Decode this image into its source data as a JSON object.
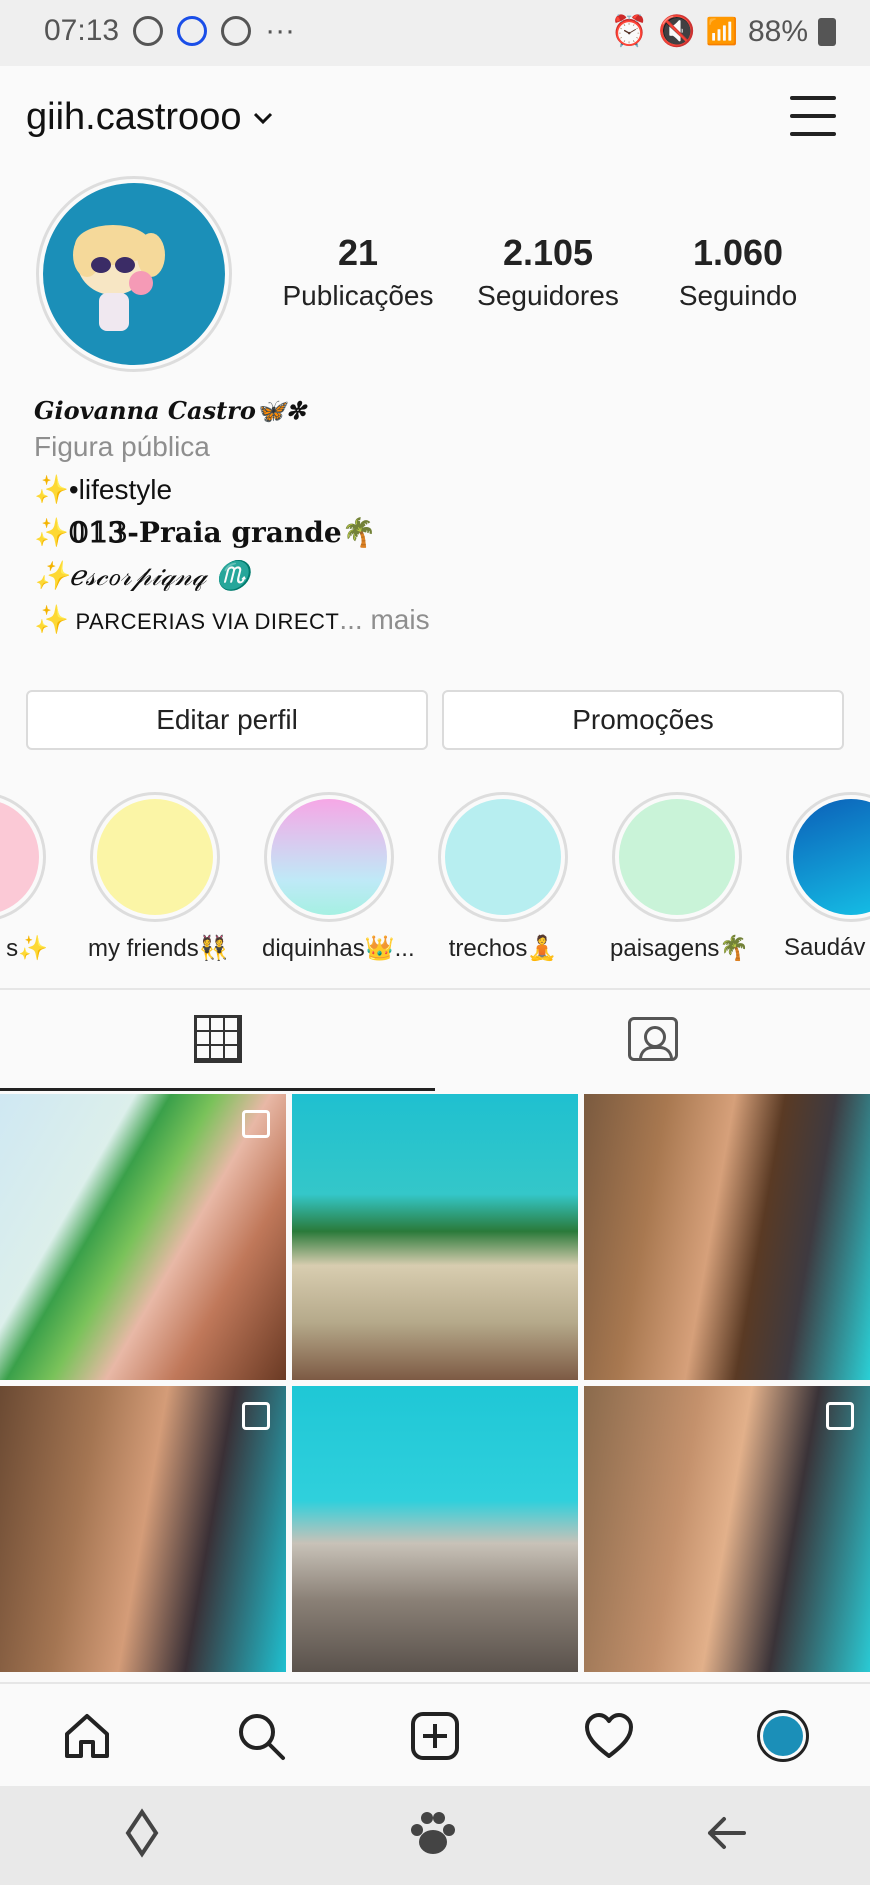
{
  "status_bar": {
    "time": "07:13",
    "more": "···",
    "battery": "88%"
  },
  "header": {
    "username": "giih.castrooo",
    "dropdown": "⌄"
  },
  "profile": {
    "stats": [
      {
        "num": "21",
        "label": "Publicações"
      },
      {
        "num": "2.105",
        "label": "Seguidores"
      },
      {
        "num": "1.060",
        "label": "Seguindo"
      }
    ],
    "name": "Giovanna Castro🦋✼",
    "category": "Figura pública",
    "bio": {
      "line1": "✨•lifestyle",
      "line2": "✨𝟘𝟙𝟛-Praia grande🌴",
      "line3": "✨ℯ𝓈𝒸ℴ𝓇𝓅𝒾𝓆𝓃𝓆 ♏",
      "line4_prefix": "✨",
      "line4": " PARCERIAS VIA DIRECT",
      "line4_more": "... mais"
    }
  },
  "buttons": {
    "edit": "Editar perfil",
    "promo": "Promoções"
  },
  "highlights": [
    {
      "label": "s✨",
      "color": "#fbc9d6"
    },
    {
      "label": "my friends👯",
      "color": "#fbf5a6"
    },
    {
      "label": "diquinhas👑...",
      "color": "linear"
    },
    {
      "label": "trechos🧘",
      "color": "#b7eef0"
    },
    {
      "label": "paisagens🌴",
      "color": "#c9f3d8"
    },
    {
      "label": "Saudáv",
      "color": "#0d8bd6"
    }
  ],
  "tabs": {
    "grid": "grid-icon",
    "tagged": "tagged-icon"
  },
  "photos": [
    {
      "desc": "selfie-palm",
      "multi": true
    },
    {
      "desc": "beach-palms",
      "multi": false
    },
    {
      "desc": "curly-portrait",
      "multi": false
    },
    {
      "desc": "curly-portrait-2",
      "multi": true
    },
    {
      "desc": "city-buildings",
      "multi": false
    },
    {
      "desc": "curly-portrait-3",
      "multi": true
    }
  ],
  "nav": [
    "home-icon",
    "search-icon",
    "add-post-icon",
    "activity-heart-icon",
    "profile-avatar-icon"
  ],
  "system_nav": [
    "recents-icon",
    "home-paw-icon",
    "back-icon"
  ]
}
